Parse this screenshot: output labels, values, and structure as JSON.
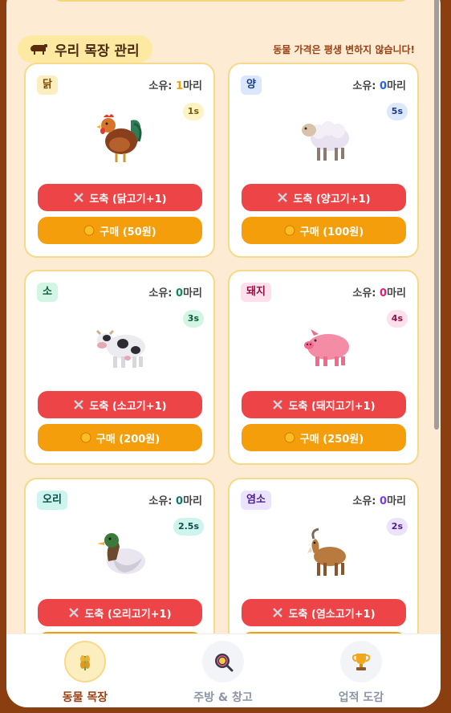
{
  "header": {
    "title": "우리 목장 관리",
    "notice": "동물 가격은 평생 변하지 않습니다!"
  },
  "animals": [
    {
      "name": "닭",
      "owned_prefix": "소유: ",
      "owned_count": "1",
      "owned_suffix": "마리",
      "timer": "1s",
      "slaughter_label": "도축 (닭고기+1)",
      "buy_label": "구매 (50원)",
      "icon": "rooster-icon",
      "accent": "#f59e0c",
      "badge_bg": "#fdeec0",
      "badge_color": "#7a4a05",
      "timer_bg": "#fdf3c4",
      "timer_color": "#7a5a05"
    },
    {
      "name": "양",
      "owned_prefix": "소유: ",
      "owned_count": "0",
      "owned_suffix": "마리",
      "timer": "5s",
      "slaughter_label": "도축 (양고기+1)",
      "buy_label": "구매 (100원)",
      "icon": "sheep-icon",
      "accent": "#2563eb",
      "badge_bg": "#dbe7fd",
      "badge_color": "#1d3d8a",
      "timer_bg": "#dde8fd",
      "timer_color": "#1d3d8a"
    },
    {
      "name": "소",
      "owned_prefix": "소유: ",
      "owned_count": "0",
      "owned_suffix": "마리",
      "timer": "3s",
      "slaughter_label": "도축 (소고기+1)",
      "buy_label": "구매 (200원)",
      "icon": "cow-icon",
      "accent": "#0f8a5f",
      "badge_bg": "#d3f5e4",
      "badge_color": "#0d5a3c",
      "timer_bg": "#d3f5e4",
      "timer_color": "#0d5a3c"
    },
    {
      "name": "돼지",
      "owned_prefix": "소유: ",
      "owned_count": "0",
      "owned_suffix": "마리",
      "timer": "4s",
      "slaughter_label": "도축 (돼지고기+1)",
      "buy_label": "구매 (250원)",
      "icon": "pig-icon",
      "accent": "#e11d74",
      "badge_bg": "#fde0ec",
      "badge_color": "#8a1244",
      "timer_bg": "#fde0ec",
      "timer_color": "#8a1244"
    },
    {
      "name": "오리",
      "owned_prefix": "소유: ",
      "owned_count": "0",
      "owned_suffix": "마리",
      "timer": "2.5s",
      "slaughter_label": "도축 (오리고기+1)",
      "buy_label": "",
      "icon": "duck-icon",
      "accent": "#0f766e",
      "badge_bg": "#cdf5ee",
      "badge_color": "#0d4f49",
      "timer_bg": "#cdf5ee",
      "timer_color": "#0d4f49"
    },
    {
      "name": "염소",
      "owned_prefix": "소유: ",
      "owned_count": "0",
      "owned_suffix": "마리",
      "timer": "2s",
      "slaughter_label": "도축 (염소고기+1)",
      "buy_label": "",
      "icon": "goat-icon",
      "accent": "#7c3aed",
      "badge_bg": "#ebe2fd",
      "badge_color": "#4c1d95",
      "timer_bg": "#ebe2fd",
      "timer_color": "#4c1d95"
    }
  ],
  "nav": {
    "items": [
      {
        "label": "동물 목장",
        "icon": "wheat-icon",
        "active": true
      },
      {
        "label": "주방 & 창고",
        "icon": "frying-pan-icon",
        "active": false
      },
      {
        "label": "업적 도감",
        "icon": "trophy-icon",
        "active": false
      }
    ]
  }
}
